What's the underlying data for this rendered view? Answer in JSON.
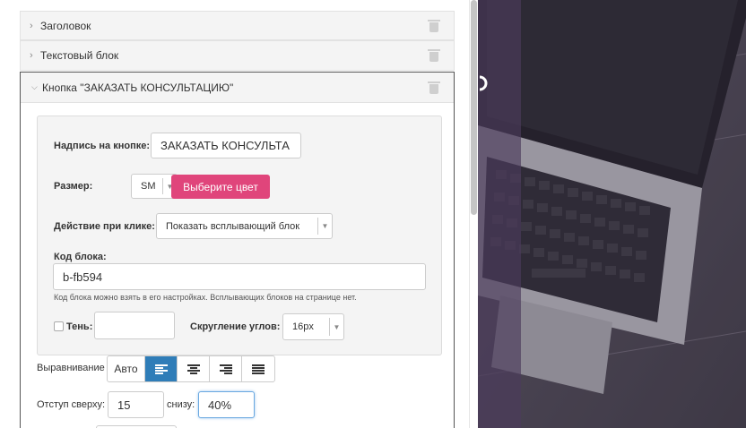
{
  "blocks": {
    "title_label": "Заголовок",
    "text_label": "Текстовый блок",
    "button_label": "Кнопка \"ЗАКАЗАТЬ КОНСУЛЬТАЦИЮ\""
  },
  "form": {
    "caption_label": "Надпись на кнопке:",
    "caption_value": "ЗАКАЗАТЬ КОНСУЛЬТА",
    "size_label": "Размер:",
    "size_value": "SM",
    "color_button": "Выберите цвет",
    "action_label": "Действие при клике:",
    "action_value": "Показать всплывающий блок",
    "code_label": "Код блока:",
    "code_value": "b-fb594",
    "code_hint": "Код блока можно взять в его настройках.  Всплывающих блоков на странице нет.",
    "shadow_label": "Тень:",
    "radius_label": "Скругление углов:",
    "radius_value": "16px",
    "align_label": "Выравнивание",
    "align_auto": "Авто",
    "margin_top_label": "Отступ сверху:",
    "margin_top_value": "15",
    "margin_bottom_label": "снизу:",
    "margin_bottom_value": "40%"
  },
  "colors": {
    "accent_button": "#e0457b",
    "active_segment": "#2f7db8"
  },
  "icons": [
    "chevron-right-icon",
    "chevron-down-icon",
    "trash-icon",
    "align-left-icon",
    "align-center-icon",
    "align-right-icon",
    "align-justify-icon"
  ]
}
